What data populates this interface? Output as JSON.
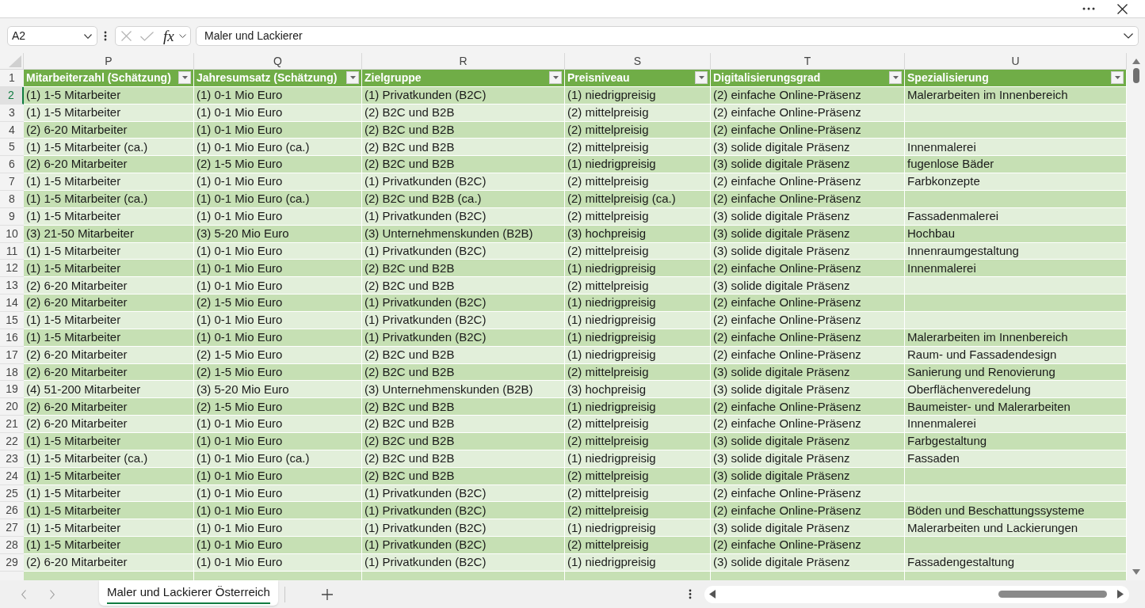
{
  "formula_bar": {
    "name_box": "A2",
    "function_label": "fx",
    "formula": "Maler und Lackierer"
  },
  "sheet": {
    "header_row_number": "1",
    "columns": [
      {
        "letter": "P",
        "title": "Mitarbeiterzahl (Schätzung)"
      },
      {
        "letter": "Q",
        "title": "Jahresumsatz (Schätzung)"
      },
      {
        "letter": "R",
        "title": "Zielgruppe"
      },
      {
        "letter": "S",
        "title": "Preisniveau"
      },
      {
        "letter": "T",
        "title": "Digitalisierungsgrad"
      },
      {
        "letter": "U",
        "title": "Spezialisierung"
      }
    ],
    "rows": [
      {
        "number": "2",
        "selected": true,
        "cells": [
          "(1) 1-5 Mitarbeiter",
          "(1) 0-1 Mio Euro",
          "(1) Privatkunden (B2C)",
          "(1) niedrigpreisig",
          "(2) einfache Online-Präsenz",
          "Malerarbeiten im Innenbereich"
        ]
      },
      {
        "number": "3",
        "selected": false,
        "cells": [
          "(1) 1-5 Mitarbeiter",
          "(1) 0-1 Mio Euro",
          "(2) B2C und B2B",
          "(2) mittelpreisig",
          "(2) einfache Online-Präsenz",
          null
        ]
      },
      {
        "number": "4",
        "selected": false,
        "cells": [
          "(2) 6-20 Mitarbeiter",
          "(1) 0-1 Mio Euro",
          "(2) B2C und B2B",
          "(2) mittelpreisig",
          "(2) einfache Online-Präsenz",
          null
        ]
      },
      {
        "number": "5",
        "selected": false,
        "cells": [
          "(1) 1-5 Mitarbeiter (ca.)",
          "(1) 0-1 Mio Euro (ca.)",
          "(2) B2C und B2B",
          "(2) mittelpreisig",
          "(3) solide digitale Präsenz",
          "Innenmalerei"
        ]
      },
      {
        "number": "6",
        "selected": false,
        "cells": [
          "(2) 6-20 Mitarbeiter",
          "(2) 1-5 Mio Euro",
          "(2) B2C und B2B",
          "(1) niedrigpreisig",
          "(3) solide digitale Präsenz",
          "fugenlose Bäder"
        ]
      },
      {
        "number": "7",
        "selected": false,
        "cells": [
          "(1) 1-5 Mitarbeiter",
          "(1) 0-1 Mio Euro",
          "(1) Privatkunden (B2C)",
          "(2) mittelpreisig",
          "(2) einfache Online-Präsenz",
          "Farbkonzepte"
        ]
      },
      {
        "number": "8",
        "selected": false,
        "cells": [
          "(1) 1-5 Mitarbeiter (ca.)",
          "(1) 0-1 Mio Euro (ca.)",
          "(2) B2C und B2B (ca.)",
          "(2) mittelpreisig (ca.)",
          "(2) einfache Online-Präsenz",
          null
        ]
      },
      {
        "number": "9",
        "selected": false,
        "cells": [
          "(1) 1-5 Mitarbeiter",
          "(1) 0-1 Mio Euro",
          "(1) Privatkunden (B2C)",
          "(2) mittelpreisig",
          "(3) solide digitale Präsenz",
          "Fassadenmalerei"
        ]
      },
      {
        "number": "10",
        "selected": false,
        "cells": [
          "(3) 21-50 Mitarbeiter",
          "(3) 5-20 Mio Euro",
          "(3) Unternehmenskunden (B2B)",
          "(3) hochpreisig",
          "(3) solide digitale Präsenz",
          "Hochbau"
        ]
      },
      {
        "number": "11",
        "selected": false,
        "cells": [
          "(1) 1-5 Mitarbeiter",
          "(1) 0-1 Mio Euro",
          "(1) Privatkunden (B2C)",
          "(2) mittelpreisig",
          "(3) solide digitale Präsenz",
          "Innenraumgestaltung"
        ]
      },
      {
        "number": "12",
        "selected": false,
        "cells": [
          "(1) 1-5 Mitarbeiter",
          "(1) 0-1 Mio Euro",
          "(2) B2C und B2B",
          "(1) niedrigpreisig",
          "(2) einfache Online-Präsenz",
          "Innenmalerei"
        ]
      },
      {
        "number": "13",
        "selected": false,
        "cells": [
          "(2) 6-20 Mitarbeiter",
          "(1) 0-1 Mio Euro",
          "(2) B2C und B2B",
          "(2) mittelpreisig",
          "(3) solide digitale Präsenz",
          null
        ]
      },
      {
        "number": "14",
        "selected": false,
        "cells": [
          "(2) 6-20 Mitarbeiter",
          "(2) 1-5 Mio Euro",
          "(1) Privatkunden (B2C)",
          "(1) niedrigpreisig",
          "(2) einfache Online-Präsenz",
          null
        ]
      },
      {
        "number": "15",
        "selected": false,
        "cells": [
          "(1) 1-5 Mitarbeiter",
          "(1) 0-1 Mio Euro",
          "(1) Privatkunden (B2C)",
          "(1) niedrigpreisig",
          "(2) einfache Online-Präsenz",
          null
        ]
      },
      {
        "number": "16",
        "selected": false,
        "cells": [
          "(1) 1-5 Mitarbeiter",
          "(1) 0-1 Mio Euro",
          "(1) Privatkunden (B2C)",
          "(1) niedrigpreisig",
          "(2) einfache Online-Präsenz",
          "Malerarbeiten im Innenbereich"
        ]
      },
      {
        "number": "17",
        "selected": false,
        "cells": [
          "(2) 6-20 Mitarbeiter",
          "(2) 1-5 Mio Euro",
          "(2) B2C und B2B",
          "(1) niedrigpreisig",
          "(2) einfache Online-Präsenz",
          "Raum- und Fassadendesign"
        ]
      },
      {
        "number": "18",
        "selected": false,
        "cells": [
          "(2) 6-20 Mitarbeiter",
          "(2) 1-5 Mio Euro",
          "(2) B2C und B2B",
          "(2) mittelpreisig",
          "(3) solide digitale Präsenz",
          "Sanierung und Renovierung"
        ]
      },
      {
        "number": "19",
        "selected": false,
        "cells": [
          "(4) 51-200 Mitarbeiter",
          "(3) 5-20 Mio Euro",
          "(3) Unternehmenskunden (B2B)",
          "(3) hochpreisig",
          "(3) solide digitale Präsenz",
          "Oberflächenveredelung"
        ]
      },
      {
        "number": "20",
        "selected": false,
        "cells": [
          "(2) 6-20 Mitarbeiter",
          "(2) 1-5 Mio Euro",
          "(2) B2C und B2B",
          "(1) niedrigpreisig",
          "(2) einfache Online-Präsenz",
          "Baumeister- und Malerarbeiten"
        ]
      },
      {
        "number": "21",
        "selected": false,
        "cells": [
          "(2) 6-20 Mitarbeiter",
          "(1) 0-1 Mio Euro",
          "(2) B2C und B2B",
          "(2) mittelpreisig",
          "(2) einfache Online-Präsenz",
          "Innenmalerei"
        ]
      },
      {
        "number": "22",
        "selected": false,
        "cells": [
          "(1) 1-5 Mitarbeiter",
          "(1) 0-1 Mio Euro",
          "(2) B2C und B2B",
          "(2) mittelpreisig",
          "(3) solide digitale Präsenz",
          "Farbgestaltung"
        ]
      },
      {
        "number": "23",
        "selected": false,
        "cells": [
          "(1) 1-5 Mitarbeiter (ca.)",
          "(1) 0-1 Mio Euro (ca.)",
          "(2) B2C und B2B",
          "(1) niedrigpreisig",
          "(3) solide digitale Präsenz",
          "Fassaden"
        ]
      },
      {
        "number": "24",
        "selected": false,
        "cells": [
          "(1) 1-5 Mitarbeiter",
          "(1) 0-1 Mio Euro",
          "(2) B2C und B2B",
          "(2) mittelpreisig",
          "(3) solide digitale Präsenz",
          null
        ]
      },
      {
        "number": "25",
        "selected": false,
        "cells": [
          "(1) 1-5 Mitarbeiter",
          "(1) 0-1 Mio Euro",
          "(1) Privatkunden (B2C)",
          "(2) mittelpreisig",
          "(2) einfache Online-Präsenz",
          null
        ]
      },
      {
        "number": "26",
        "selected": false,
        "cells": [
          "(1) 1-5 Mitarbeiter",
          "(1) 0-1 Mio Euro",
          "(1) Privatkunden (B2C)",
          "(2) mittelpreisig",
          "(2) einfache Online-Präsenz",
          "Böden und Beschattungssysteme"
        ]
      },
      {
        "number": "27",
        "selected": false,
        "cells": [
          "(1) 1-5 Mitarbeiter",
          "(1) 0-1 Mio Euro",
          "(1) Privatkunden (B2C)",
          "(1) niedrigpreisig",
          "(3) solide digitale Präsenz",
          "Malerarbeiten und Lackierungen"
        ]
      },
      {
        "number": "28",
        "selected": false,
        "cells": [
          "(1) 1-5 Mitarbeiter",
          "(1) 0-1 Mio Euro",
          "(1) Privatkunden (B2C)",
          "(2) mittelpreisig",
          "(2) einfache Online-Präsenz",
          null
        ]
      },
      {
        "number": "29",
        "selected": false,
        "cells": [
          "(2) 6-20 Mitarbeiter",
          "(1) 0-1 Mio Euro",
          "(1) Privatkunden (B2C)",
          "(1) niedrigpreisig",
          "(3) solide digitale Präsenz",
          "Fassadengestaltung"
        ]
      }
    ]
  },
  "sheet_tabs": [
    {
      "label": "Maler und Lackierer Österreich",
      "selected": true
    }
  ]
}
